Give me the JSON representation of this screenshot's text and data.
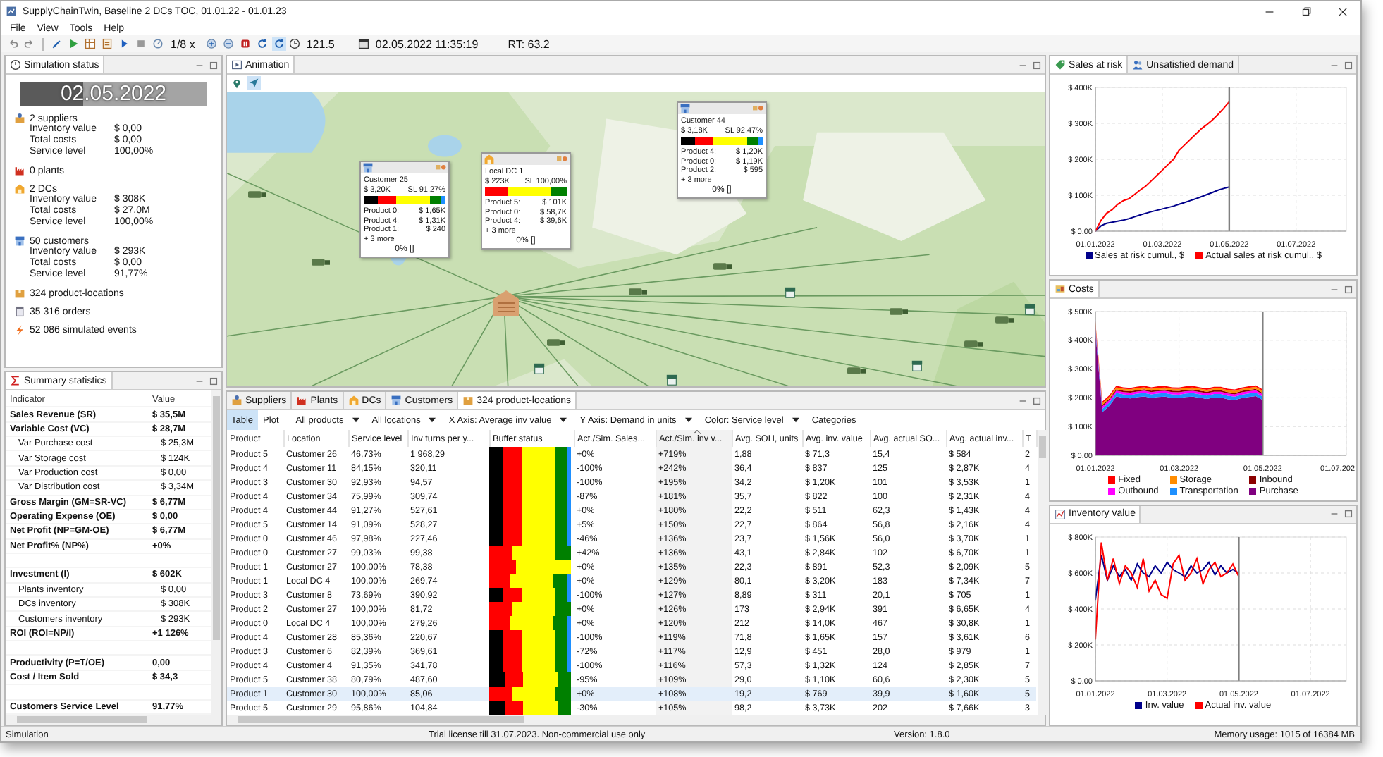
{
  "window": {
    "title": "SupplyChainTwin,  Baseline 2 DCs TOC, 01.01.22 - 01.01.23"
  },
  "menu": [
    "File",
    "View",
    "Tools",
    "Help"
  ],
  "toolbar": {
    "speed": "1/8 x",
    "model_time": "121.5",
    "date_time": "02.05.2022 11:35:19",
    "rt": "RT: 63.2"
  },
  "simulation_status": {
    "tab": "Simulation status",
    "date": "02.05.2022",
    "level": 0.34,
    "groups": [
      {
        "kind": "suppliers",
        "title": "2 suppliers",
        "fields": [
          {
            "label": "Inventory value",
            "value": "$ 0,00"
          },
          {
            "label": "Total costs",
            "value": "$ 0,00"
          },
          {
            "label": "Service level",
            "value": "100,00%"
          }
        ]
      },
      {
        "kind": "plants",
        "title": "0 plants"
      },
      {
        "kind": "dcs",
        "title": "2 DCs",
        "fields": [
          {
            "label": "Inventory value",
            "value": "$ 308K"
          },
          {
            "label": "Total costs",
            "value": "$ 27,0M"
          },
          {
            "label": "Service level",
            "value": "100,00%"
          }
        ]
      },
      {
        "kind": "customers",
        "title": "50 customers",
        "fields": [
          {
            "label": "Inventory value",
            "value": "$ 293K"
          },
          {
            "label": "Total costs",
            "value": "$ 0,00"
          },
          {
            "label": "Service level",
            "value": "91,77%"
          }
        ]
      },
      {
        "kind": "product_locations",
        "title": "324 product-locations"
      },
      {
        "kind": "orders",
        "title": "35 316 orders"
      },
      {
        "kind": "events",
        "title": "52 086 simulated events"
      }
    ]
  },
  "summary_statistics": {
    "tab": "Summary statistics",
    "columns": [
      "Indicator",
      "Value"
    ],
    "rows": [
      {
        "kind": "row",
        "label": "Sales Revenue (SR)",
        "value": "$ 35,5M"
      },
      {
        "kind": "row",
        "label": "Variable Cost (VC)",
        "value": "$ 28,7M",
        "children": [
          {
            "label": "Var Purchase cost",
            "value": "$ 25,3M"
          },
          {
            "label": "Var Storage cost",
            "value": "$ 124K"
          },
          {
            "label": "Var Production cost",
            "value": "$ 0,00"
          },
          {
            "label": "Var Distribution cost",
            "value": "$ 3,34M"
          }
        ]
      },
      {
        "kind": "row",
        "label": "Gross Margin (GM=SR-VC)",
        "value": "$ 6,77M"
      },
      {
        "kind": "row",
        "label": "Operating Expense (OE)",
        "value": "$ 0,00"
      },
      {
        "kind": "row",
        "label": "Net Profit (NP=GM-OE)",
        "value": "$ 6,77M"
      },
      {
        "kind": "row",
        "label": "Net Profit% (NP%)",
        "value": "+0%"
      },
      {
        "kind": "gap"
      },
      {
        "kind": "row",
        "label": "Investment (I)",
        "value": "$ 602K",
        "children": [
          {
            "label": "Plants inventory",
            "value": "$ 0,00"
          },
          {
            "label": "DCs inventory",
            "value": "$ 308K"
          },
          {
            "label": "Customers inventory",
            "value": "$ 293K"
          }
        ]
      },
      {
        "kind": "row",
        "label": "ROI (ROI=NP/I)",
        "value": "+1 126%"
      },
      {
        "kind": "gap"
      },
      {
        "kind": "row",
        "label": "Productivity (P=T/OE)",
        "value": "0,00"
      },
      {
        "kind": "row",
        "label": "Cost / Item Sold",
        "value": "$ 34,3"
      },
      {
        "kind": "gap"
      },
      {
        "kind": "row",
        "label": "Customers Service Level",
        "value": "91,77%"
      }
    ]
  },
  "animation": {
    "tab": "Animation",
    "tools": [
      {
        "kind": "pin",
        "selected": false
      },
      {
        "kind": "pointer",
        "selected": true
      }
    ],
    "popups": [
      {
        "kind": "customers",
        "title": "Customer 25",
        "value": "$ 3,20K",
        "service": "SL 91,27%",
        "buffer": [
          {
            "color": "#000000"
          },
          {
            "color": "#ff0000"
          },
          {
            "color": "#ffff00"
          },
          {
            "color": "#008000"
          },
          {
            "color": "#1e90ff"
          }
        ],
        "products": [
          {
            "name": "Product 0:",
            "value": "$ 1,65K"
          },
          {
            "name": "Product 4:",
            "value": "$ 1,31K"
          },
          {
            "name": "Product 1:",
            "value": "$ 240"
          }
        ],
        "more": "+ 3 more",
        "footer": "0% []"
      },
      {
        "kind": "dcs",
        "title": "Local DC 1",
        "value": "$ 223K",
        "service": "SL 100,00%",
        "buffer": [
          {
            "color": "#ff0000"
          },
          {
            "color": "#ffff00"
          },
          {
            "color": "#008000"
          }
        ],
        "products": [
          {
            "name": "Product 5:",
            "value": "$ 101K"
          },
          {
            "name": "Product 0:",
            "value": "$ 58,7K"
          },
          {
            "name": "Product 4:",
            "value": "$ 39,6K"
          }
        ],
        "more": "+ 3 more",
        "footer": "0% []"
      },
      {
        "kind": "customers",
        "title": "Customer 44",
        "value": "$ 3,18K",
        "service": "SL 92,47%",
        "buffer": [
          {
            "color": "#000000"
          },
          {
            "color": "#ff0000"
          },
          {
            "color": "#ffff00"
          },
          {
            "color": "#008000"
          },
          {
            "color": "#1e90ff"
          }
        ],
        "products": [
          {
            "name": "Product 4:",
            "value": "$ 1,20K"
          },
          {
            "name": "Product 0:",
            "value": "$ 1,19K"
          },
          {
            "name": "Product 2:",
            "value": "$ 595"
          }
        ],
        "more": "+ 3 more",
        "footer": "0% []"
      }
    ]
  },
  "table_panel": {
    "tabs": [
      {
        "kind": "suppliers",
        "label": "Suppliers",
        "selected": false
      },
      {
        "kind": "plants",
        "label": "Plants",
        "selected": false
      },
      {
        "kind": "dcs",
        "label": "DCs",
        "selected": false
      },
      {
        "kind": "customers",
        "label": "Customers",
        "selected": false
      },
      {
        "kind": "product_locations",
        "label": "324 product-locations",
        "selected": true
      }
    ],
    "views": [
      {
        "label": "Table",
        "selected": true
      },
      {
        "label": "Plot",
        "selected": false
      }
    ],
    "filters": [
      "All products",
      "All locations",
      "X Axis: Average inv value",
      "Y Axis: Demand in units",
      "Color: Service level"
    ],
    "categories": "Categories",
    "columns": [
      {
        "label": "Product",
        "sorted": false
      },
      {
        "label": "Location",
        "sorted": false
      },
      {
        "label": "Service level",
        "sorted": false
      },
      {
        "label": "Inv turns per y...",
        "sorted": false
      },
      {
        "label": "Buffer status",
        "sorted": false
      },
      {
        "label": "Act./Sim. Sales...",
        "sorted": false
      },
      {
        "label": "Act./Sim. inv v...",
        "sorted": true
      },
      {
        "label": "Avg. SOH, units",
        "sorted": false
      },
      {
        "label": "Avg. inv. value",
        "sorted": false
      },
      {
        "label": "Avg. actual SO...",
        "sorted": false
      },
      {
        "label": "Avg. actual inv...",
        "sorted": false
      },
      {
        "label": "T",
        "sorted": false
      }
    ],
    "rows": [
      {
        "selected": false,
        "cells": [
          "Product 5",
          "Customer 26",
          "46,73%",
          "1 968,29",
          "",
          "+0%",
          "+719%",
          "1,88",
          "$ 71,3",
          "15,4",
          "$ 584",
          "2"
        ],
        "buffer": [
          {
            "color": "#000000"
          },
          {
            "color": "#ff0000"
          },
          {
            "color": "#ffff00"
          },
          {
            "color": "#008000"
          },
          {
            "color": "#1e90ff"
          }
        ]
      },
      {
        "selected": false,
        "cells": [
          "Product 4",
          "Customer 11",
          "84,15%",
          "320,11",
          "",
          "-100%",
          "+242%",
          "36,4",
          "$ 837",
          "125",
          "$ 2,87K",
          "4"
        ],
        "buffer": [
          {
            "color": "#000000"
          },
          {
            "color": "#ff0000"
          },
          {
            "color": "#ffff00"
          },
          {
            "color": "#008000"
          },
          {
            "color": "#1e90ff"
          }
        ]
      },
      {
        "selected": false,
        "cells": [
          "Product 3",
          "Customer 30",
          "92,93%",
          "94,57",
          "",
          "-100%",
          "+195%",
          "34,2",
          "$ 1,20K",
          "101",
          "$ 3,53K",
          "1"
        ],
        "buffer": [
          {
            "color": "#000000"
          },
          {
            "color": "#ff0000"
          },
          {
            "color": "#ffff00"
          },
          {
            "color": "#008000"
          },
          {
            "color": "#1e90ff"
          }
        ]
      },
      {
        "selected": false,
        "cells": [
          "Product 4",
          "Customer 34",
          "75,99%",
          "309,74",
          "",
          "-87%",
          "+181%",
          "35,7",
          "$ 822",
          "100",
          "$ 2,31K",
          "4"
        ],
        "buffer": [
          {
            "color": "#000000"
          },
          {
            "color": "#ff0000"
          },
          {
            "color": "#ffff00"
          },
          {
            "color": "#008000"
          },
          {
            "color": "#1e90ff"
          }
        ]
      },
      {
        "selected": false,
        "cells": [
          "Product 4",
          "Customer 44",
          "91,27%",
          "527,61",
          "",
          "+0%",
          "+180%",
          "22,2",
          "$ 511",
          "62,3",
          "$ 1,43K",
          "4"
        ],
        "buffer": [
          {
            "color": "#000000"
          },
          {
            "color": "#ff0000"
          },
          {
            "color": "#ffff00"
          },
          {
            "color": "#008000"
          },
          {
            "color": "#1e90ff"
          }
        ]
      },
      {
        "selected": false,
        "cells": [
          "Product 5",
          "Customer 14",
          "91,09%",
          "528,27",
          "",
          "+5%",
          "+150%",
          "22,7",
          "$ 864",
          "56,8",
          "$ 2,16K",
          "4"
        ],
        "buffer": [
          {
            "color": "#000000"
          },
          {
            "color": "#ff0000"
          },
          {
            "color": "#ffff00"
          },
          {
            "color": "#008000"
          },
          {
            "color": "#1e90ff"
          }
        ]
      },
      {
        "selected": false,
        "cells": [
          "Product 0",
          "Customer 46",
          "97,98%",
          "227,46",
          "",
          "-46%",
          "+136%",
          "23,7",
          "$ 1,56K",
          "56,0",
          "$ 3,70K",
          "1"
        ],
        "buffer": [
          {
            "color": "#000000"
          },
          {
            "color": "#ff0000"
          },
          {
            "color": "#ffff00"
          },
          {
            "color": "#008000"
          },
          {
            "color": "#1e90ff"
          }
        ]
      },
      {
        "selected": false,
        "cells": [
          "Product 0",
          "Customer 27",
          "99,03%",
          "99,38",
          "",
          "+42%",
          "+136%",
          "43,1",
          "$ 2,84K",
          "102",
          "$ 6,70K",
          "1"
        ],
        "buffer": [
          {
            "color": "#ff0000"
          },
          {
            "color": "#ffff00"
          },
          {
            "color": "#008000"
          }
        ]
      },
      {
        "selected": false,
        "cells": [
          "Product 1",
          "Customer 27",
          "100,00%",
          "78,38",
          "",
          "+0%",
          "+135%",
          "22,3",
          "$ 891",
          "52,3",
          "$ 2,09K",
          "5"
        ],
        "buffer": [
          {
            "color": "#ff0000"
          },
          {
            "color": "#ffff00"
          }
        ]
      },
      {
        "selected": false,
        "cells": [
          "Product 1",
          "Local DC 4",
          "100,00%",
          "269,74",
          "",
          "+0%",
          "+129%",
          "80,1",
          "$ 3,20K",
          "183",
          "$ 7,34K",
          "7"
        ],
        "buffer": [
          {
            "color": "#ff0000"
          },
          {
            "color": "#ffff00"
          },
          {
            "color": "#008000"
          },
          {
            "color": "#1e90ff"
          }
        ]
      },
      {
        "selected": false,
        "cells": [
          "Product 3",
          "Customer 8",
          "73,69%",
          "390,92",
          "",
          "-100%",
          "+127%",
          "8,89",
          "$ 311",
          "20,1",
          "$ 705",
          "1"
        ],
        "buffer": [
          {
            "color": "#000000"
          },
          {
            "color": "#ff0000"
          },
          {
            "color": "#ffff00"
          },
          {
            "color": "#008000"
          },
          {
            "color": "#1e90ff"
          }
        ]
      },
      {
        "selected": false,
        "cells": [
          "Product 2",
          "Customer 27",
          "100,00%",
          "81,72",
          "",
          "+0%",
          "+126%",
          "173",
          "$ 2,94K",
          "391",
          "$ 6,65K",
          "4"
        ],
        "buffer": [
          {
            "color": "#ff0000"
          },
          {
            "color": "#ffff00"
          },
          {
            "color": "#008000"
          }
        ]
      },
      {
        "selected": false,
        "cells": [
          "Product 0",
          "Local DC 4",
          "100,00%",
          "279,26",
          "",
          "+0%",
          "+120%",
          "212",
          "$ 14,0K",
          "467",
          "$ 30,8K",
          "1"
        ],
        "buffer": [
          {
            "color": "#ff0000"
          },
          {
            "color": "#ffff00"
          },
          {
            "color": "#008000"
          },
          {
            "color": "#1e90ff"
          }
        ]
      },
      {
        "selected": false,
        "cells": [
          "Product 4",
          "Customer 28",
          "85,36%",
          "220,67",
          "",
          "-100%",
          "+119%",
          "71,8",
          "$ 1,65K",
          "157",
          "$ 3,61K",
          "6"
        ],
        "buffer": [
          {
            "color": "#000000"
          },
          {
            "color": "#ff0000"
          },
          {
            "color": "#ffff00"
          },
          {
            "color": "#008000"
          },
          {
            "color": "#1e90ff"
          }
        ]
      },
      {
        "selected": false,
        "cells": [
          "Product 3",
          "Customer 6",
          "82,39%",
          "369,61",
          "",
          "-72%",
          "+117%",
          "12,9",
          "$ 451",
          "28,0",
          "$ 979",
          "1"
        ],
        "buffer": [
          {
            "color": "#000000"
          },
          {
            "color": "#ff0000"
          },
          {
            "color": "#ffff00"
          },
          {
            "color": "#008000"
          },
          {
            "color": "#1e90ff"
          }
        ]
      },
      {
        "selected": false,
        "cells": [
          "Product 4",
          "Customer 4",
          "91,35%",
          "341,78",
          "",
          "-100%",
          "+116%",
          "57,3",
          "$ 1,32K",
          "124",
          "$ 2,85K",
          "7"
        ],
        "buffer": [
          {
            "color": "#000000"
          },
          {
            "color": "#ff0000"
          },
          {
            "color": "#ffff00"
          },
          {
            "color": "#008000"
          },
          {
            "color": "#1e90ff"
          }
        ]
      },
      {
        "selected": false,
        "cells": [
          "Product 5",
          "Customer 38",
          "80,79%",
          "487,60",
          "",
          "-95%",
          "+109%",
          "29,0",
          "$ 1,10K",
          "60,6",
          "$ 2,30K",
          "5"
        ],
        "buffer": [
          {
            "color": "#000000"
          },
          {
            "color": "#ff0000"
          },
          {
            "color": "#ffff00"
          },
          {
            "color": "#008000"
          }
        ]
      },
      {
        "selected": true,
        "cells": [
          "Product 1",
          "Customer 30",
          "100,00%",
          "85,06",
          "",
          "+0%",
          "+108%",
          "19,2",
          "$ 769",
          "39,9",
          "$ 1,60K",
          "5"
        ],
        "buffer": [
          {
            "color": "#ff0000"
          },
          {
            "color": "#ffff00"
          },
          {
            "color": "#008000"
          }
        ]
      },
      {
        "selected": false,
        "cells": [
          "Product 5",
          "Customer 29",
          "95,86%",
          "104,84",
          "",
          "-30%",
          "+105%",
          "98,2",
          "$ 3,73K",
          "202",
          "$ 7,66K",
          "3"
        ],
        "buffer": [
          {
            "color": "#000000"
          },
          {
            "color": "#ff0000"
          },
          {
            "color": "#ffff00"
          },
          {
            "color": "#008000"
          }
        ]
      }
    ]
  },
  "charts": [
    {
      "tabs": [
        {
          "kind": "tag",
          "label": "Sales at risk",
          "selected": true
        },
        {
          "kind": "people",
          "label": "Unsatisfied demand",
          "selected": false
        }
      ],
      "chart_data": {
        "type": "line",
        "grid": true,
        "legend": "bottom",
        "categories": [
          "01.01.2022",
          null,
          null,
          null,
          null,
          null,
          null,
          null,
          null,
          null,
          null,
          null,
          "01.03.2022",
          null,
          null,
          null,
          null,
          null,
          null,
          null,
          null,
          null,
          null,
          null,
          "01.05.2022",
          null,
          null,
          null,
          null,
          null,
          null,
          null,
          null,
          null,
          null,
          null,
          "01.07.2022",
          null,
          null,
          null,
          null,
          null,
          null,
          null,
          null,
          null
        ],
        "ylim": [
          0,
          400000
        ],
        "yticks": [
          {
            "value": 0,
            "label": "$ 0.00"
          },
          {
            "value": 100000,
            "label": "$ 100K"
          },
          {
            "value": 200000,
            "label": "$ 200K"
          },
          {
            "value": 300000,
            "label": "$ 300K"
          },
          {
            "value": 400000,
            "label": "$ 400K"
          }
        ],
        "series": [
          {
            "name": "Sales at risk cumul., $",
            "color": "#00008b",
            "values": [
              0,
              15000,
              22000,
              25000,
              28000,
              31000,
              35000,
              40000,
              45000,
              50000,
              54000,
              58000,
              62000,
              66000,
              70000,
              75000,
              80000,
              85000,
              90000,
              96000,
              102000,
              108000,
              114000,
              119000,
              123000,
              null,
              null,
              null,
              null,
              null,
              null,
              null,
              null,
              null,
              null,
              null,
              null,
              null,
              null,
              null,
              null,
              null,
              null,
              null,
              null,
              null
            ]
          },
          {
            "name": "Actual sales at risk cumul., $",
            "color": "#ff0000",
            "values": [
              0,
              30000,
              50000,
              60000,
              75000,
              85000,
              90000,
              102000,
              114000,
              125000,
              140000,
              155000,
              170000,
              185000,
              200000,
              225000,
              240000,
              255000,
              270000,
              285000,
              297000,
              310000,
              325000,
              342000,
              360000,
              null,
              null,
              null,
              null,
              null,
              null,
              null,
              null,
              null,
              null,
              null,
              null,
              null,
              null,
              null,
              null,
              null,
              null,
              null,
              null,
              null
            ]
          }
        ]
      }
    },
    {
      "tabs": [
        {
          "kind": "coins",
          "label": "Costs",
          "selected": true
        }
      ],
      "chart_data": {
        "type": "area",
        "stacked": true,
        "grid": true,
        "legend": "bottom",
        "categories": [
          "01.01.2022",
          null,
          null,
          null,
          null,
          null,
          null,
          null,
          null,
          null,
          null,
          null,
          "01.03.2022",
          null,
          null,
          null,
          null,
          null,
          null,
          null,
          null,
          null,
          null,
          null,
          "01.05.2022",
          null,
          null,
          null,
          null,
          null,
          null,
          null,
          null,
          null,
          null,
          null,
          "01.07.202"
        ],
        "ylim": [
          0,
          500000
        ],
        "yticks": [
          {
            "value": 0,
            "label": "$ 0.00"
          },
          {
            "value": 100000,
            "label": "$ 100K"
          },
          {
            "value": 200000,
            "label": "$ 200K"
          },
          {
            "value": 300000,
            "label": "$ 300K"
          },
          {
            "value": 400000,
            "label": "$ 400K"
          },
          {
            "value": 500000,
            "label": "$ 500K"
          }
        ],
        "series": [
          {
            "name": "Purchase",
            "color": "#800080",
            "values": [
              430000,
              150000,
              172000,
              205000,
              200000,
              198000,
              202000,
              205000,
              200000,
              203000,
              204000,
              200000,
              199000,
              203000,
              204000,
              200000,
              196000,
              201000,
              201000,
              195000,
              192000,
              199000,
              203000,
              206000,
              192000,
              null,
              null,
              null,
              null,
              null,
              null,
              null,
              null,
              null,
              null,
              null,
              null
            ]
          },
          {
            "name": "Transportation",
            "color": "#1e90ff",
            "values": [
              12000,
              12000,
              12000,
              12000,
              12000,
              12000,
              12000,
              12000,
              12000,
              12000,
              12000,
              12000,
              12000,
              12000,
              12000,
              12000,
              12000,
              12000,
              12000,
              12000,
              12000,
              12000,
              12000,
              12000,
              12000,
              null,
              null,
              null,
              null,
              null,
              null,
              null,
              null,
              null,
              null,
              null,
              null
            ]
          },
          {
            "name": "Outbound",
            "color": "#ff00ff",
            "values": [
              8000,
              8000,
              8000,
              8000,
              8000,
              8000,
              8000,
              8000,
              8000,
              8000,
              8000,
              8000,
              8000,
              8000,
              8000,
              8000,
              8000,
              8000,
              8000,
              8000,
              8000,
              8000,
              8000,
              8000,
              8000,
              null,
              null,
              null,
              null,
              null,
              null,
              null,
              null,
              null,
              null,
              null,
              null
            ]
          },
          {
            "name": "Inbound",
            "color": "#8b0000",
            "values": [
              5000,
              5000,
              5000,
              5000,
              5000,
              5000,
              5000,
              5000,
              5000,
              5000,
              5000,
              5000,
              5000,
              5000,
              5000,
              5000,
              5000,
              5000,
              5000,
              5000,
              5000,
              5000,
              5000,
              5000,
              5000,
              null,
              null,
              null,
              null,
              null,
              null,
              null,
              null,
              null,
              null,
              null,
              null
            ]
          },
          {
            "name": "Storage",
            "color": "#ff8c00",
            "values": [
              7000,
              7000,
              7000,
              7000,
              7000,
              7000,
              7000,
              7000,
              7000,
              7000,
              7000,
              7000,
              7000,
              7000,
              7000,
              7000,
              7000,
              7000,
              7000,
              7000,
              7000,
              7000,
              7000,
              7000,
              7000,
              null,
              null,
              null,
              null,
              null,
              null,
              null,
              null,
              null,
              null,
              null,
              null
            ]
          },
          {
            "name": "Fixed",
            "color": "#ff0000",
            "values": [
              5000,
              5000,
              5000,
              5000,
              5000,
              5000,
              5000,
              5000,
              5000,
              5000,
              5000,
              5000,
              5000,
              5000,
              5000,
              5000,
              5000,
              5000,
              5000,
              5000,
              5000,
              5000,
              5000,
              5000,
              5000,
              null,
              null,
              null,
              null,
              null,
              null,
              null,
              null,
              null,
              null,
              null,
              null
            ]
          }
        ]
      }
    },
    {
      "tabs": [
        {
          "kind": "chart",
          "label": "Inventory value",
          "selected": true
        }
      ],
      "chart_data": {
        "type": "line",
        "grid": true,
        "legend": "bottom",
        "categories": [
          "01.01.2022",
          null,
          null,
          null,
          null,
          null,
          null,
          null,
          null,
          null,
          null,
          null,
          "01.03.2022",
          null,
          null,
          null,
          null,
          null,
          null,
          null,
          null,
          null,
          null,
          null,
          "01.05.2022",
          null,
          null,
          null,
          null,
          null,
          null,
          null,
          null,
          null,
          null,
          null,
          "01.07.2022",
          null,
          null,
          null,
          null,
          null,
          null
        ],
        "ylim": [
          0,
          800000
        ],
        "yticks": [
          {
            "value": 0,
            "label": "$ 0.00"
          },
          {
            "value": 200000,
            "label": "$ 200K"
          },
          {
            "value": 400000,
            "label": "$ 400K"
          },
          {
            "value": 600000,
            "label": "$ 600K"
          },
          {
            "value": 800000,
            "label": "$ 800K"
          }
        ],
        "series": [
          {
            "name": "Inv. value",
            "color": "#00008b",
            "values": [
              450000,
              700000,
              560000,
              640000,
              580000,
              620000,
              560000,
              650000,
              600000,
              580000,
              640000,
              600000,
              660000,
              620000,
              600000,
              580000,
              640000,
              600000,
              620000,
              660000,
              590000,
              640000,
              600000,
              620000,
              600000,
              null,
              null,
              null,
              null,
              null,
              null,
              null,
              null,
              null,
              null,
              null,
              null,
              null,
              null,
              null,
              null,
              null,
              null
            ]
          },
          {
            "name": "Actual inv. value",
            "color": "#ff0000",
            "values": [
              230000,
              770000,
              560000,
              680000,
              540000,
              640000,
              600000,
              520000,
              680000,
              500000,
              560000,
              480000,
              460000,
              650000,
              700000,
              560000,
              600000,
              680000,
              540000,
              620000,
              660000,
              580000,
              600000,
              650000,
              580000,
              null,
              null,
              null,
              null,
              null,
              null,
              null,
              null,
              null,
              null,
              null,
              null,
              null,
              null,
              null,
              null,
              null,
              null
            ]
          }
        ]
      }
    }
  ],
  "status_bar": {
    "mode": "Simulation",
    "license": "Trial license till 31.07.2023. Non-commercial use only",
    "version": "Version: 1.8.0",
    "memory": "Memory usage: 1015 of 16384 MB"
  }
}
